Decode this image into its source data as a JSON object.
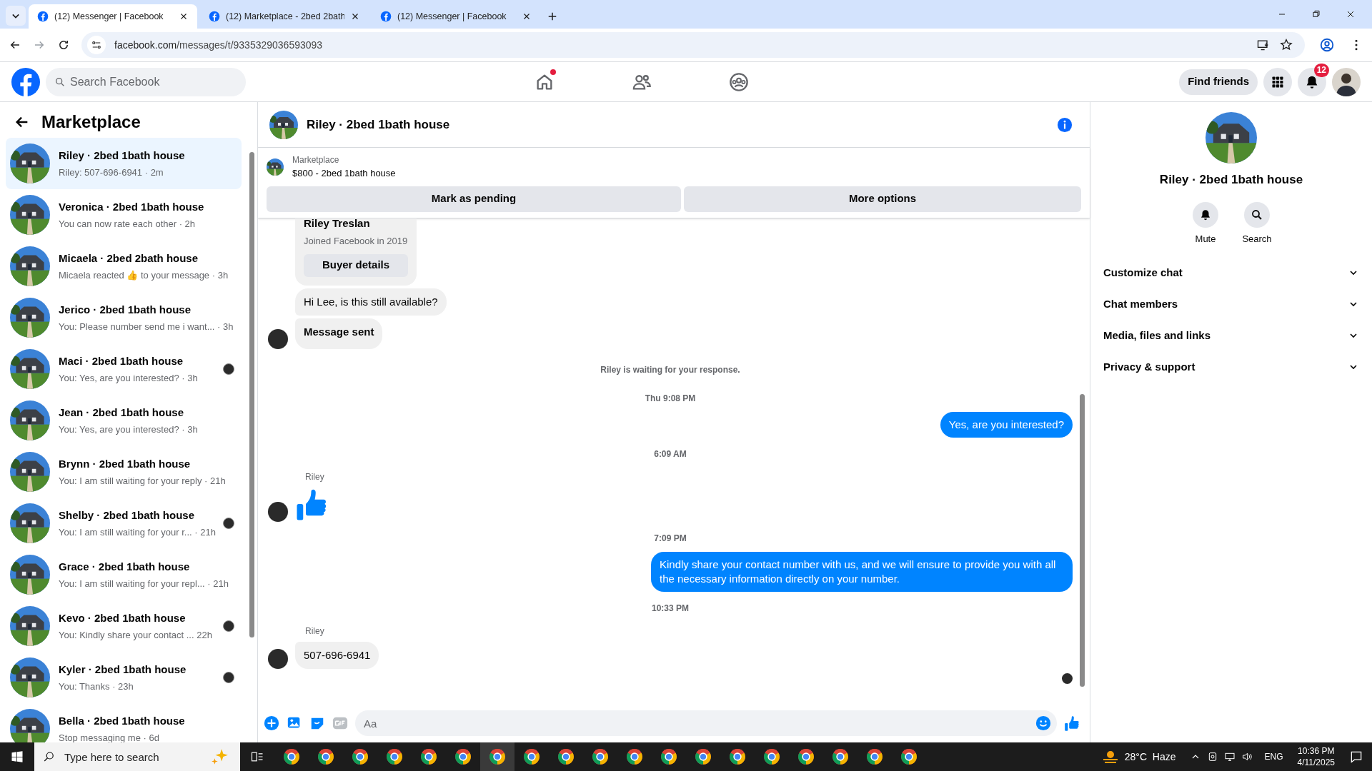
{
  "browser": {
    "tabs": [
      {
        "title": "(12) Messenger | Facebook",
        "selected": true
      },
      {
        "title": "(12) Marketplace - 2bed 2bath",
        "selected": false
      },
      {
        "title": "(12) Messenger | Facebook",
        "selected": false
      }
    ],
    "url_host": "facebook.com",
    "url_path": "/messages/t/9335329036593093"
  },
  "header": {
    "search_placeholder": "Search Facebook",
    "nav": [
      {
        "kind": "home",
        "selected": false,
        "dot": true
      },
      {
        "kind": "friends",
        "selected": false,
        "dot": false
      },
      {
        "kind": "groups",
        "selected": false,
        "dot": false
      }
    ],
    "find_friends": "Find friends",
    "notifications": "12"
  },
  "sidebar": {
    "title": "Marketplace",
    "conversations": [
      {
        "name": "Riley · 2bed 1bath house",
        "meta": "Riley: 507-696-6941 · 2m",
        "selected": true,
        "seen": false
      },
      {
        "name": "Veronica · 2bed 1bath house",
        "meta": "You can now rate each other · 2h",
        "selected": false,
        "seen": false
      },
      {
        "name": "Micaela · 2bed 2bath house",
        "meta": "Micaela reacted 👍 to your message · 3h",
        "selected": false,
        "seen": false
      },
      {
        "name": "Jerico · 2bed 1bath house",
        "meta": "You: Please number send me i want... · 3h",
        "selected": false,
        "seen": false
      },
      {
        "name": "Maci · 2bed 1bath house",
        "meta": "You: Yes, are you interested? · 3h",
        "selected": false,
        "seen": true
      },
      {
        "name": "Jean · 2bed 1bath house",
        "meta": "You: Yes, are you interested? · 3h",
        "selected": false,
        "seen": false
      },
      {
        "name": "Brynn · 2bed 1bath house",
        "meta": "You: I am still waiting for your reply · 21h",
        "selected": false,
        "seen": false
      },
      {
        "name": "Shelby · 2bed 1bath house",
        "meta": "You: I am still waiting for your r... · 21h",
        "selected": false,
        "seen": true
      },
      {
        "name": "Grace · 2bed 1bath house",
        "meta": "You: I am still waiting for your repl... · 21h",
        "selected": false,
        "seen": false
      },
      {
        "name": "Kevo · 2bed 1bath house",
        "meta": "You: Kindly share your contact ...  22h",
        "selected": false,
        "seen": true
      },
      {
        "name": "Kyler · 2bed 1bath house",
        "meta": "You: Thanks · 23h",
        "selected": false,
        "seen": true
      },
      {
        "name": "Bella · 2bed 1bath house",
        "meta": "Stop messaging me · 6d",
        "selected": false,
        "seen": false
      }
    ]
  },
  "chat": {
    "title": "Riley · 2bed 1bath house",
    "listing": {
      "label": "Marketplace",
      "title": "$800 - 2bed 1bath house"
    },
    "actions": [
      "Mark as pending",
      "More options"
    ],
    "messages": [
      {
        "kind": "profile",
        "name": "Riley Treslan",
        "subtitle": "Joined Facebook in 2019",
        "button": "Buyer details"
      },
      {
        "kind": "incoming",
        "text": "Hi Lee, is this still available?",
        "avatar": false,
        "bold": false
      },
      {
        "kind": "incoming",
        "text": "Message sent",
        "avatar": true,
        "bold": true
      },
      {
        "kind": "notice",
        "text": "Riley is waiting for your response."
      },
      {
        "kind": "time",
        "text": "Thu 9:08 PM"
      },
      {
        "kind": "outgoing",
        "text": "Yes, are you interested?"
      },
      {
        "kind": "time",
        "text": "6:09 AM"
      },
      {
        "kind": "sender",
        "text": "Riley"
      },
      {
        "kind": "like"
      },
      {
        "kind": "time",
        "text": "7:09 PM"
      },
      {
        "kind": "outgoing",
        "text": "Kindly share your contact number with us, and we will ensure to provide you with all the necessary information directly on your number."
      },
      {
        "kind": "time",
        "text": "10:33 PM"
      },
      {
        "kind": "sender",
        "text": "Riley"
      },
      {
        "kind": "incoming",
        "text": "507-696-6941",
        "avatar": true,
        "bold": false
      },
      {
        "kind": "seen"
      }
    ],
    "composer_placeholder": "Aa"
  },
  "details": {
    "title": "Riley · 2bed 1bath house",
    "actions": [
      "Mute",
      "Search"
    ],
    "sections": [
      {
        "label": "Customize chat",
        "expanded": false
      },
      {
        "label": "Chat members",
        "expanded": false
      },
      {
        "label": "Media, files and links",
        "expanded": false
      },
      {
        "label": "Privacy & support",
        "expanded": false
      }
    ]
  },
  "taskbar": {
    "search_placeholder": "Type here to search",
    "weather": "28°C  Haze",
    "language": "ENG",
    "time": "10:36 PM",
    "date": "4/11/2025"
  }
}
